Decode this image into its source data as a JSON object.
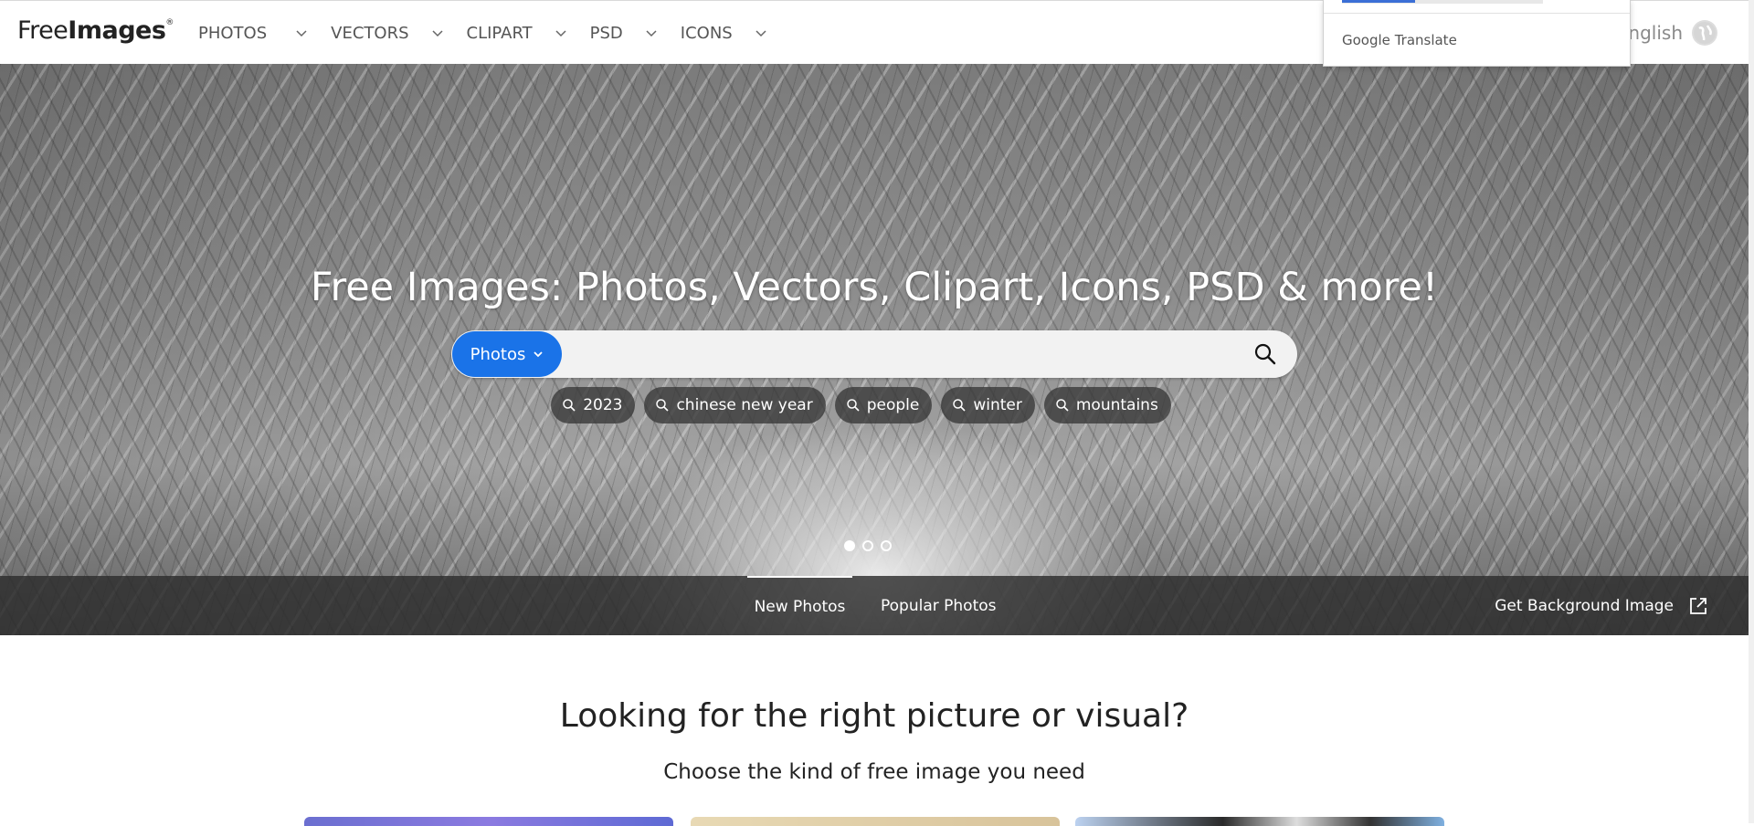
{
  "header": {
    "logo_part1": "Free",
    "logo_part2": "Images",
    "logo_reg": "®",
    "nav": [
      {
        "label": "PHOTOS"
      },
      {
        "label": "VECTORS"
      },
      {
        "label": "CLIPART"
      },
      {
        "label": "PSD"
      },
      {
        "label": "ICONS"
      }
    ],
    "language": "English"
  },
  "google_translate": {
    "brand_google": "Google",
    "brand_translate": "Translate"
  },
  "hero": {
    "title": "Free Images: Photos, Vectors, Clipart, Icons, PSD & more!",
    "search_type": "Photos",
    "search_value": "",
    "tags": [
      "2023",
      "chinese new year",
      "people",
      "winter",
      "mountains"
    ],
    "slides": 3,
    "active_slide": 1,
    "tabs": {
      "new": "New Photos",
      "popular": "Popular Photos"
    },
    "background_link": "Get Background Image"
  },
  "section": {
    "title": "Looking for the right picture or visual?",
    "subtitle": "Choose the kind of free image you need"
  },
  "colors": {
    "accent": "#1a73e8",
    "overlay": "#2d2d2d"
  }
}
